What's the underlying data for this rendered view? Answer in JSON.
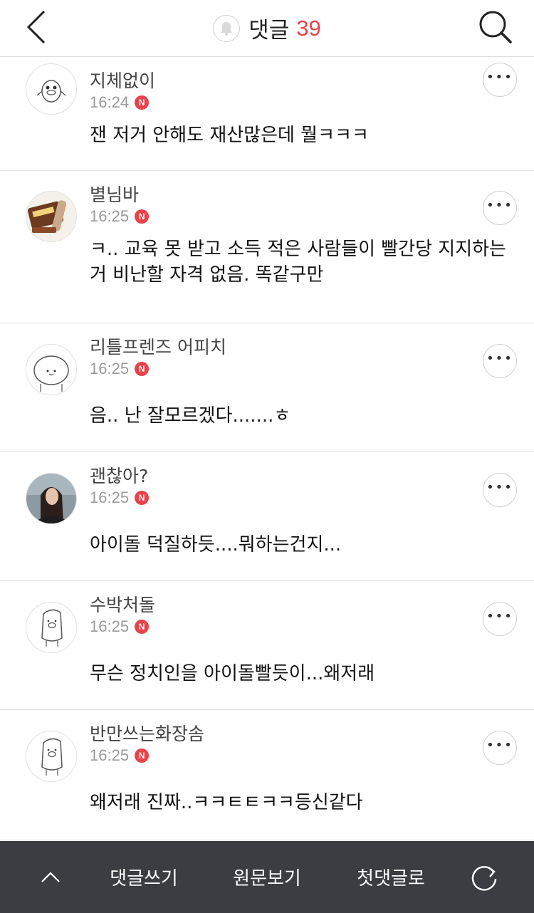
{
  "header": {
    "title": "댓글",
    "count": "39",
    "accent_color": "#e8434b",
    "back_icon": "chevron-left-icon",
    "bell_icon": "bell-icon",
    "search_icon": "search-icon"
  },
  "comments": [
    {
      "author": "지체없이",
      "time": "16:24",
      "badge": "N",
      "text": "잰 저거 안해도 재산많은데 뭘ㅋㅋㅋ",
      "avatar": "cartoon-bird-avatar"
    },
    {
      "author": "별님바",
      "time": "16:25",
      "badge": "N",
      "text": "ㅋ.. 교육 못 받고 소득 적은 사람들이 빨간당 지지하는 거 비난할 자격 없음. 똑같구만",
      "avatar": "ice-cream-bar-avatar"
    },
    {
      "author": "리틀프렌즈 어피치",
      "time": "16:25",
      "badge": "N",
      "text": "음.. 난 잘모르겠다.......ㅎ",
      "avatar": "round-character-avatar"
    },
    {
      "author": "괜찮아?",
      "time": "16:25",
      "badge": "N",
      "text": "아이돌 덕질하듯....뭐하는건지...",
      "avatar": "woman-photo-avatar"
    },
    {
      "author": "수박처돌",
      "time": "16:25",
      "badge": "N",
      "text": "무슨 정치인을 아이돌빨듯이...왜저래",
      "avatar": "pig-character-avatar"
    },
    {
      "author": "반만쓰는화장솜",
      "time": "16:25",
      "badge": "N",
      "text": "왜저래 진짜..ㅋㅋㅌㅌㅋㅋ등신같다",
      "avatar": "pig-character-avatar"
    }
  ],
  "more_label": "•••",
  "bottom_bar": {
    "up_icon": "chevron-up-icon",
    "write": "댓글쓰기",
    "original": "원문보기",
    "first_comment": "첫댓글로",
    "refresh_icon": "refresh-icon",
    "bg_color": "#3b3d43"
  }
}
